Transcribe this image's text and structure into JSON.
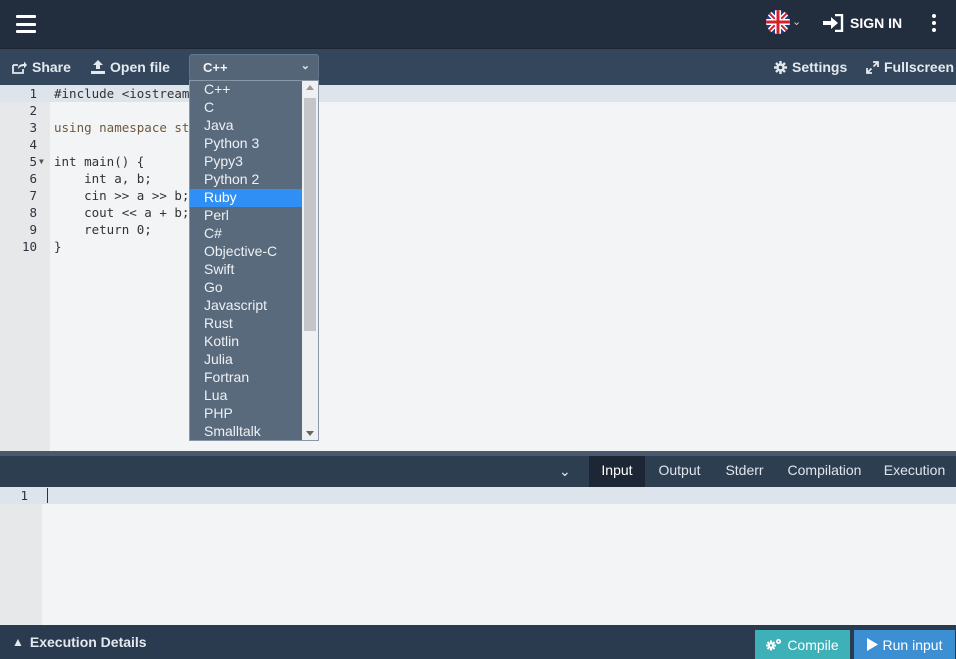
{
  "header": {
    "menu_icon": "hamburger-icon",
    "language_flag_icon": "uk-flag-icon",
    "signin_label": "SIGN IN",
    "more_icon": "vertical-dots-icon"
  },
  "toolbar": {
    "share_label": "Share",
    "open_file_label": "Open file",
    "language_selected": "C++",
    "settings_label": "Settings",
    "fullscreen_label": "Fullscreen"
  },
  "editor": {
    "lines": [
      {
        "num": "1",
        "code": "#include <iostream"
      },
      {
        "num": "2",
        "code": ""
      },
      {
        "num": "3",
        "code": "using namespace st"
      },
      {
        "num": "4",
        "code": ""
      },
      {
        "num": "5",
        "code": "int main() {"
      },
      {
        "num": "6",
        "code": "    int a, b;"
      },
      {
        "num": "7",
        "code": "    cin >> a >> b;"
      },
      {
        "num": "8",
        "code": "    cout << a + b;"
      },
      {
        "num": "9",
        "code": "    return 0;"
      },
      {
        "num": "10",
        "code": "}"
      }
    ]
  },
  "language_dropdown": {
    "options": [
      "C++",
      "C",
      "Java",
      "Python 3",
      "Pypy3",
      "Python 2",
      "Ruby",
      "Perl",
      "C#",
      "Objective-C",
      "Swift",
      "Go",
      "Javascript",
      "Rust",
      "Kotlin",
      "Julia",
      "Fortran",
      "Lua",
      "PHP",
      "Smalltalk"
    ],
    "highlighted": "Ruby"
  },
  "io_tabs": {
    "tabs": [
      "Input",
      "Output",
      "Stderr",
      "Compilation",
      "Execution"
    ],
    "active": "Input"
  },
  "input_panel": {
    "line_number": "1",
    "value": ""
  },
  "footer": {
    "execution_details_label": "Execution Details",
    "compile_label": "Compile",
    "run_label": "Run input"
  },
  "colors": {
    "navbar": "#222d3d",
    "toolbar": "#34465b",
    "compile_button": "#3eb0b8",
    "run_button": "#3c8fd3",
    "dropdown_highlight": "#2f8ff4"
  }
}
